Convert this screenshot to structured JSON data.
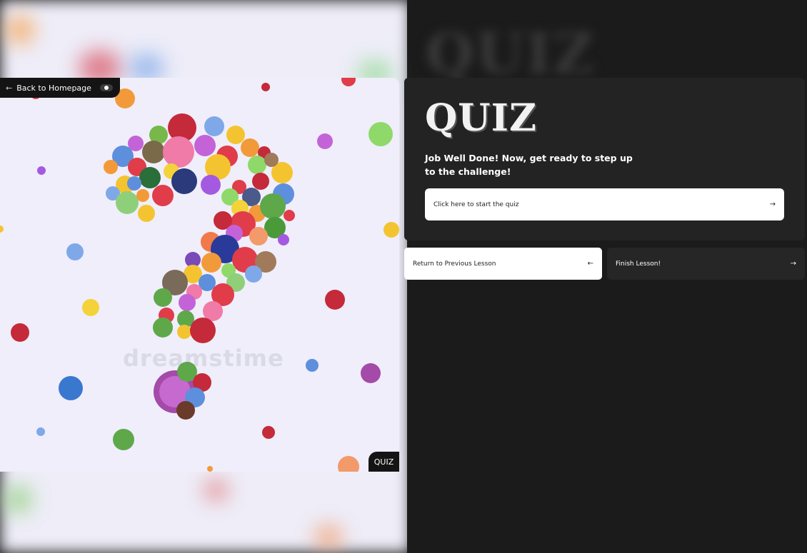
{
  "nav": {
    "back_label": "Back to Homepage",
    "back_arrow": "←"
  },
  "image": {
    "watermark": "dreamstime",
    "caption_tab": "QUIZ"
  },
  "quiz": {
    "logo": "QUIZ",
    "message": "Job Well Done! Now, get ready to step up to the challenge!",
    "start_label": "Click here to start the quiz",
    "start_arrow": "→"
  },
  "lesson_nav": {
    "prev_label": "Return to Previous Lesson",
    "prev_arrow": "←",
    "finish_label": "Finish Lesson!",
    "finish_arrow": "→"
  },
  "colors": {
    "panel": "#232323",
    "page_bg": "#141414",
    "image_bg": "#efeefa"
  },
  "icons": [
    "arrow-left-icon",
    "toggle-icon",
    "arrow-right-icon"
  ]
}
